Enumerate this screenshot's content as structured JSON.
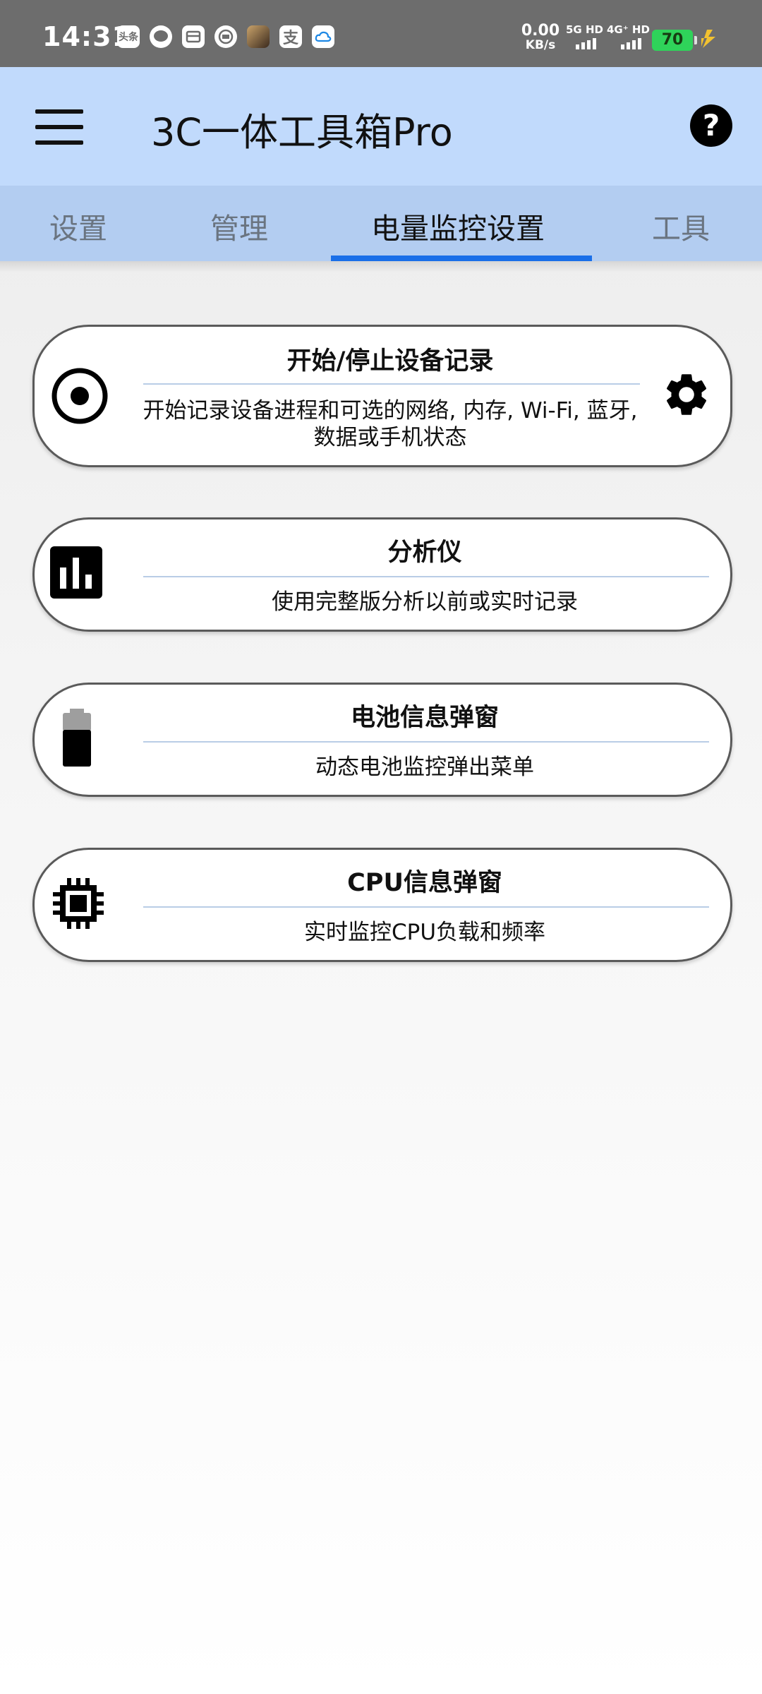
{
  "status_bar": {
    "time": "14:31",
    "notification_icons": [
      "toutiao-icon",
      "message-icon",
      "wallet-icon",
      "app-icon",
      "photo-app-icon",
      "alipay-icon",
      "cloud-icon"
    ],
    "toutiao_label": "头条",
    "alipay_label": "支",
    "speed_value": "0.00",
    "speed_unit": "KB/s",
    "sim1": "5G HD",
    "sim2": "4G⁺ HD",
    "battery_level": "70",
    "battery_color": "#2fd35a"
  },
  "appbar": {
    "title": "3C一体工具箱Pro",
    "menu_icon": "hamburger-menu-icon",
    "help_icon": "help-icon",
    "help_glyph": "?",
    "background": "#c1dafc"
  },
  "tabs": {
    "items": [
      {
        "label": "设置",
        "active": false
      },
      {
        "label": "管理",
        "active": false
      },
      {
        "label": "电量监控设置",
        "active": true
      },
      {
        "label": "工具",
        "active": false
      }
    ],
    "indicator_color": "#1a6fe8"
  },
  "cards": [
    {
      "icon": "record-icon",
      "title": "开始/停止设备记录",
      "description": "开始记录设备进程和可选的网络, 内存, Wi-Fi, 蓝牙, 数据或手机状态",
      "action_icon": "gear-icon"
    },
    {
      "icon": "bar-chart-icon",
      "title": "分析仪",
      "description": "使用完整版分析以前或实时记录"
    },
    {
      "icon": "battery-icon",
      "title": "电池信息弹窗",
      "description": "动态电池监控弹出菜单"
    },
    {
      "icon": "cpu-chip-icon",
      "title": "CPU信息弹窗",
      "description": "实时监控CPU负载和频率"
    }
  ]
}
